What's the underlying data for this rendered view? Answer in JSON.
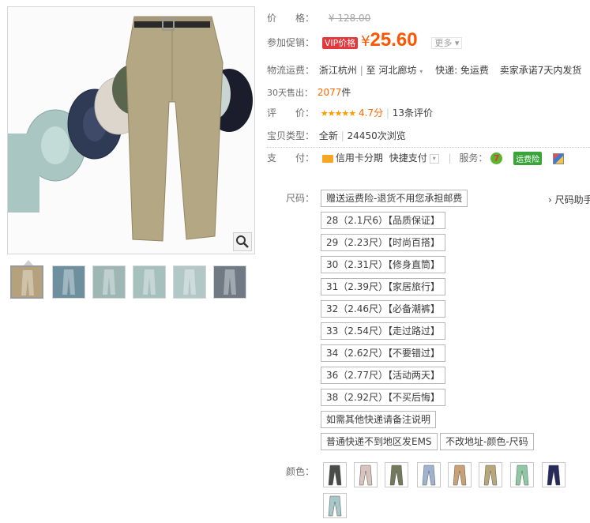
{
  "price_row": {
    "label": "价　　格：",
    "currency": "¥",
    "original": "128.00"
  },
  "promo_row": {
    "label": "参加促销：",
    "vip": "VIP价格",
    "currency": "¥",
    "price": "25.60",
    "more": "更多"
  },
  "shipping_row": {
    "label": "物流运费：",
    "from": "浙江杭州",
    "to_prefix": "至",
    "to": "河北廊坊",
    "express": "快递: 免运费",
    "promise": "卖家承诺7天内发货"
  },
  "sales_row": {
    "label": "30天售出：",
    "count": "2077",
    "unit": "件"
  },
  "rating_row": {
    "label": "评　　价：",
    "stars": "★★★★★",
    "score": "4.7分",
    "reviews": "13条评价"
  },
  "type_row": {
    "label": "宝贝类型：",
    "condition": "全新",
    "views": "24450次浏览"
  },
  "pay_row": {
    "label": "支　　付：",
    "credit": "信用卡分期",
    "quick": "快捷支付",
    "service_label": "服务：",
    "seven": "7",
    "insurance": "运费险"
  },
  "size": {
    "label": "尺码：",
    "helper": "尺码助手",
    "options": [
      "赠送运费险-退货不用您承担邮费",
      "28（2.1尺6）【品质保证】",
      "29（2.23尺）【时尚百搭】",
      "30（2.31尺）【修身直筒】",
      "31（2.39尺）【家居旅行】",
      "32（2.46尺）【必备潮裤】",
      "33（2.54尺）【走过路过】",
      "34（2.62尺）【不要错过】",
      "36（2.77尺）【活动两天】",
      "38（2.92尺）【不买后悔】",
      "如需其他快递请备注说明",
      "普通快递不到地区发EMS",
      "不改地址-颜色-尺码"
    ]
  },
  "color": {
    "label": "颜色：",
    "swatches": [
      "#4a4c4a",
      "#d9c3bd",
      "#737a5c",
      "#9fb3d1",
      "#c9a173",
      "#b8a879",
      "#8fc9a4",
      "#262b5c",
      "#a7c7c8"
    ]
  },
  "thumb_colors": [
    "#b5a27d",
    "#6e8f9e",
    "#9fb7b4",
    "#a6c0bd",
    "#b2c8c6",
    "#707a85"
  ]
}
